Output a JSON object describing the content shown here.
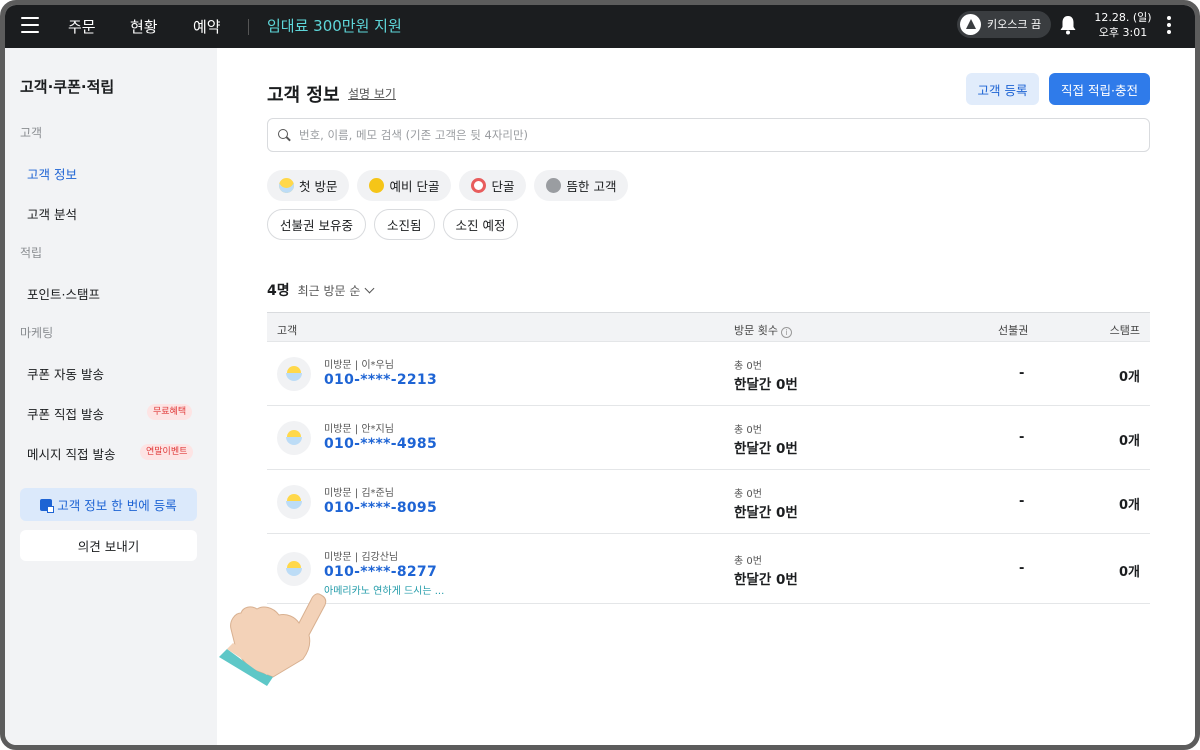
{
  "topbar": {
    "nav": [
      "주문",
      "현황",
      "예약"
    ],
    "promo": "임대료 300만원 지원",
    "kiosk": "키오스크 끔",
    "date": "12.28. (일)",
    "time": "오후 3:01"
  },
  "sidebar": {
    "title": "고객·쿠폰·적립",
    "sections": {
      "customer": "고객",
      "points": "적립",
      "marketing": "마케팅"
    },
    "items": {
      "customer_info": "고객 정보",
      "customer_analysis": "고객 분석",
      "point_stamp": "포인트·스탬프",
      "coupon_auto": "쿠폰 자동 발송",
      "coupon_direct": "쿠폰 직접 발송",
      "message_direct": "메시지 직접 발송"
    },
    "badges": {
      "coupon_direct": "무료혜택",
      "message_direct": "연말이벤트"
    },
    "bulk_register": "고객 정보 한 번에 등록",
    "feedback": "의견 보내기"
  },
  "main": {
    "title": "고객 정보",
    "help": "설명 보기",
    "register_btn": "고객 등록",
    "charge_btn": "직접 적립·충전",
    "search_placeholder": "번호, 이름, 메모 검색 (기존 고객은 뒷 4자리만)",
    "chips": [
      "첫 방문",
      "예비 단골",
      "단골",
      "뜸한 고객"
    ],
    "chip_colors": [
      "#ffd84a",
      "#f5c518",
      "#e85d5d",
      "#9a9da1"
    ],
    "filters": [
      "선불권 보유중",
      "소진됨",
      "소진 예정"
    ],
    "count": "4명",
    "sort": "최근 방문 순",
    "columns": {
      "customer": "고객",
      "visits": "방문 횟수",
      "prepaid": "선불권",
      "stamp": "스탬프"
    },
    "rows": [
      {
        "sub": "미방문 | 이*우님",
        "phone": "010-****-2213",
        "memo": "",
        "visit_total": "총 0번",
        "visit_month": "한달간 0번",
        "prepaid": "-",
        "stamp": "0개"
      },
      {
        "sub": "미방문 | 안*지님",
        "phone": "010-****-4985",
        "memo": "",
        "visit_total": "총 0번",
        "visit_month": "한달간 0번",
        "prepaid": "-",
        "stamp": "0개"
      },
      {
        "sub": "미방문 | 김*준님",
        "phone": "010-****-8095",
        "memo": "",
        "visit_total": "총 0번",
        "visit_month": "한달간 0번",
        "prepaid": "-",
        "stamp": "0개"
      },
      {
        "sub": "미방문 | 김강산님",
        "phone": "010-****-8277",
        "memo": "아메리카노 연하게 드시는 ...",
        "visit_total": "총 0번",
        "visit_month": "한달간 0번",
        "prepaid": "-",
        "stamp": "0개"
      }
    ]
  },
  "colors": {
    "accent": "#2f7bea",
    "promo": "#5ed6d9",
    "topbar": "#1b1d1f",
    "sidebar": "#f2f3f5"
  }
}
